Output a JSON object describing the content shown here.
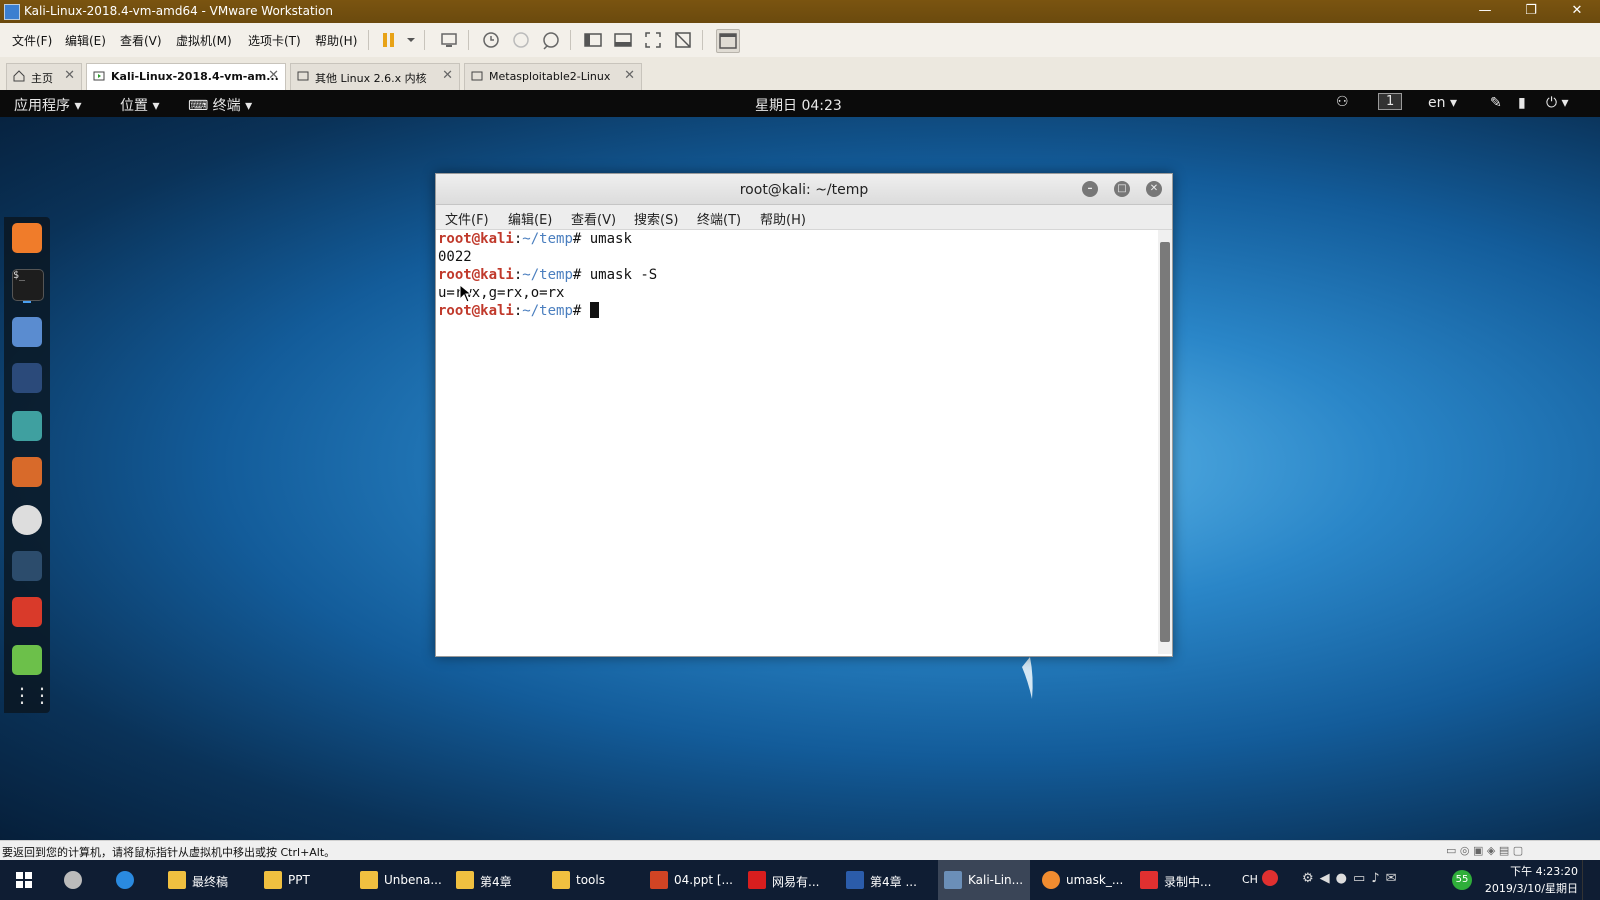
{
  "vmware": {
    "window_title": "Kali-Linux-2018.4-vm-amd64 - VMware Workstation",
    "menu": [
      "文件(F)",
      "编辑(E)",
      "查看(V)",
      "虚拟机(M)",
      "选项卡(T)",
      "帮助(H)"
    ],
    "tabs": [
      {
        "label": "主页",
        "active": false
      },
      {
        "label": "Kali-Linux-2018.4-vm-am...",
        "active": true
      },
      {
        "label": "其他 Linux 2.6.x 内核",
        "active": false
      },
      {
        "label": "Metasploitable2-Linux",
        "active": false
      }
    ],
    "status_hint": "要返回到您的计算机，请将鼠标指针从虚拟机中移出或按 Ctrl+Alt。"
  },
  "kali_panel": {
    "applications": "应用程序",
    "places": "位置",
    "terminal": "终端",
    "clock": "星期日 04:23",
    "workspace": "1",
    "language": "en"
  },
  "terminal": {
    "title": "root@kali: ~/temp",
    "menu": [
      "文件(F)",
      "编辑(E)",
      "查看(V)",
      "搜索(S)",
      "终端(T)",
      "帮助(H)"
    ],
    "prompt_user": "root@kali",
    "prompt_sep": ":",
    "prompt_path": "~/temp",
    "prompt_hash": "#",
    "cmd1": " umask",
    "out1": "0022",
    "cmd2": " umask -S",
    "out2": "u=rwx,g=rx,o=rx",
    "cmd3": " "
  },
  "taskbar": {
    "items": [
      "最终稿",
      "PPT",
      "Unbena...",
      "第4章",
      "tools",
      "04.ppt [...",
      "网易有...",
      "第4章 ...",
      "Kali-Lin...",
      "umask_...",
      "录制中..."
    ],
    "time": "下午 4:23:20",
    "date": "2019/3/10/星期日",
    "ime": "CH",
    "badge": "55"
  },
  "colors": {
    "prompt_user": "#c0392b",
    "prompt_path": "#4b7fbf",
    "vmware_title": "#7a5410"
  }
}
